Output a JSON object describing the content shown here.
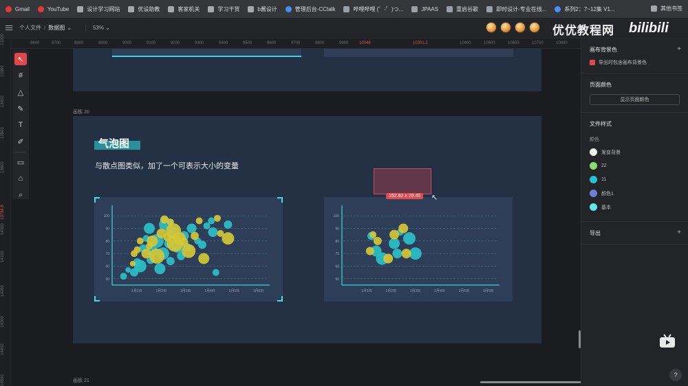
{
  "bookmarks": [
    {
      "label": "Gmail",
      "icon": "mail-icon"
    },
    {
      "label": "YouTube",
      "icon": "youtube-icon"
    },
    {
      "label": "设计学习网站",
      "icon": "folder-icon"
    },
    {
      "label": "优设助教",
      "icon": "folder-icon"
    },
    {
      "label": "客家机关",
      "icon": "folder-icon"
    },
    {
      "label": "学习干货",
      "icon": "folder-icon"
    },
    {
      "label": "b酱设计",
      "icon": "folder-icon"
    },
    {
      "label": "管理后台-CCtalk",
      "icon": "cctalk-icon"
    },
    {
      "label": "哔哩哔哩 (゜-゜)つ...",
      "icon": "bilibili-icon"
    },
    {
      "label": "JPAAS",
      "icon": "app-icon"
    },
    {
      "label": "重启谷歌",
      "icon": "globe-icon"
    },
    {
      "label": "即时设计-专业在线...",
      "icon": "js-design-icon"
    },
    {
      "label": "系列2：7~12集 V1...",
      "icon": "doc-icon"
    }
  ],
  "bookmarks_other": "其他书签",
  "topbar": {
    "breadcrumb_parent": "个人文件",
    "breadcrumb_sep": "/",
    "breadcrumb_current": "数据图",
    "zoom": "53%"
  },
  "watermark": "优优教程网",
  "watermark_brand": "bilibili",
  "ruler_top": [
    "8600",
    "8700",
    "8800",
    "8900",
    "9000",
    "9100",
    "9200",
    "9300",
    "9400",
    "9500",
    "9600",
    "9700",
    "9800",
    "9900",
    "10048",
    "10201.2",
    "10400",
    "10500",
    "10600",
    "10700",
    "10800"
  ],
  "ruler_left": [
    "13200",
    "13300",
    "13400",
    "13500",
    "13600",
    "13734.8",
    "14000",
    "14100",
    "14200",
    "14300",
    "14400",
    "14500"
  ],
  "canvas": {
    "board20_label": "画板 20",
    "board21_label": "画板 21",
    "title": "气泡图",
    "subtitle": "与散点图类似，加了一个可表示大小的变量",
    "selection_size": "152.82 x 29.45"
  },
  "chart_data": [
    {
      "type": "scatter",
      "y_ticks": [
        "50",
        "60",
        "70",
        "80",
        "90",
        "100"
      ],
      "ylim": [
        45,
        105
      ],
      "categories": [
        "1月1日",
        "1月2日",
        "1月3日",
        "1月4日",
        "1月5日",
        "1月6日"
      ],
      "series": [
        {
          "color": "#2bbfc8",
          "points": [
            [
              0.3,
              52,
              5
            ],
            [
              0.6,
              57,
              4
            ],
            [
              1.0,
              55,
              6
            ],
            [
              1.2,
              63,
              6
            ],
            [
              1.4,
              60,
              9
            ],
            [
              1.6,
              74,
              6
            ],
            [
              1.8,
              82,
              5
            ],
            [
              2.0,
              90,
              8
            ],
            [
              2.1,
              65,
              6
            ],
            [
              2.2,
              72,
              8
            ],
            [
              2.5,
              80,
              10
            ],
            [
              2.7,
              58,
              8
            ],
            [
              2.9,
              70,
              9
            ],
            [
              3.1,
              93,
              10
            ],
            [
              3.3,
              78,
              7
            ],
            [
              3.4,
              64,
              6
            ],
            [
              3.6,
              86,
              9
            ],
            [
              3.9,
              76,
              10
            ],
            [
              4.1,
              68,
              6
            ],
            [
              4.3,
              84,
              7
            ],
            [
              4.5,
              75,
              6
            ],
            [
              4.8,
              90,
              7
            ],
            [
              5.2,
              80,
              5
            ],
            [
              5.5,
              77,
              6
            ],
            [
              5.8,
              92,
              5
            ],
            [
              6.2,
              87,
              7
            ],
            [
              6.4,
              55,
              5
            ],
            [
              6.1,
              96,
              5
            ],
            [
              7.2,
              93,
              6
            ]
          ]
        },
        {
          "color": "#d4c736",
          "points": [
            [
              0.9,
              62,
              4
            ],
            [
              1.0,
              70,
              5
            ],
            [
              1.2,
              73,
              5
            ],
            [
              1.4,
              80,
              5
            ],
            [
              1.8,
              70,
              7
            ],
            [
              2.0,
              76,
              5
            ],
            [
              2.2,
              80,
              8
            ],
            [
              2.5,
              68,
              11
            ],
            [
              2.8,
              86,
              7
            ],
            [
              3.0,
              97,
              6
            ],
            [
              3.2,
              83,
              6
            ],
            [
              3.4,
              95,
              5
            ],
            [
              3.6,
              88,
              11
            ],
            [
              3.7,
              78,
              12
            ],
            [
              4.0,
              82,
              9
            ],
            [
              4.3,
              79,
              6
            ],
            [
              4.6,
              72,
              10
            ],
            [
              5.0,
              84,
              6
            ],
            [
              5.3,
              96,
              5
            ],
            [
              5.6,
              66,
              8
            ],
            [
              6.5,
              98,
              5
            ],
            [
              6.7,
              86,
              5
            ],
            [
              7.2,
              82,
              9
            ]
          ]
        }
      ]
    },
    {
      "type": "scatter",
      "y_ticks": [
        "50",
        "60",
        "70",
        "80",
        "90",
        "100"
      ],
      "ylim": [
        45,
        105
      ],
      "categories": [
        "1月1日",
        "1月2日",
        "1月3日",
        "1月4日",
        "1月5日",
        "1月6日"
      ],
      "series": [
        {
          "color": "#2bbfc8",
          "points": [
            [
              1.5,
              84,
              6
            ],
            [
              1.8,
              72,
              8
            ],
            [
              2.2,
              66,
              9
            ],
            [
              3.0,
              78,
              8
            ],
            [
              3.2,
              70,
              7
            ],
            [
              3.4,
              87,
              5
            ],
            [
              4.0,
              82,
              9
            ],
            [
              4.4,
              70,
              9
            ]
          ]
        },
        {
          "color": "#d4c736",
          "points": [
            [
              1.4,
              72,
              6
            ],
            [
              1.6,
              85,
              5
            ],
            [
              1.9,
              80,
              6
            ],
            [
              2.6,
              66,
              7
            ],
            [
              3.0,
              85,
              7
            ],
            [
              3.6,
              90,
              7
            ],
            [
              3.8,
              70,
              7
            ]
          ]
        }
      ]
    }
  ],
  "panel": {
    "canvas_bg_title": "画布背景色",
    "export_with_bg": "导出时包含画布背景色",
    "page_color_title": "页面颜色",
    "show_page_color": "显示页面颜色",
    "file_styles_title": "文件样式",
    "colors_sub": "颜色",
    "swatches": [
      {
        "label": "渐变背景",
        "color": "#f3f3f3"
      },
      {
        "label": "22",
        "color": "#8fdc6e"
      },
      {
        "label": "11",
        "color": "#22c3d6"
      },
      {
        "label": "颜色1",
        "color": "#6f7fd8"
      },
      {
        "label": "基本",
        "color": "#5ee6ea"
      }
    ],
    "export_title": "导出",
    "help": "?"
  }
}
